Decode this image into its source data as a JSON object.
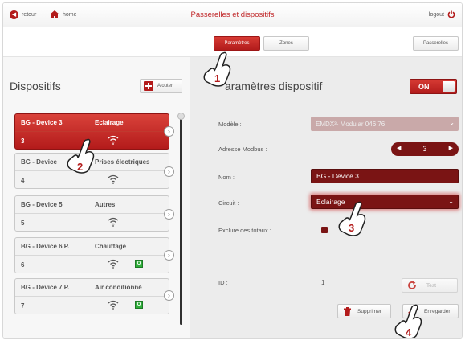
{
  "header": {
    "back_label": "retour",
    "home_label": "home",
    "title": "Passerelles et dispositifs",
    "logout_label": "logout"
  },
  "tabs": {
    "parametres": "Paramètres",
    "zones": "Zones",
    "passerelles": "Passerelles"
  },
  "left_panel": {
    "title": "Dispositifs",
    "add_label": "Ajouter",
    "devices": [
      {
        "name": "BG - Device 3",
        "circuit": "Eclairage",
        "number": "3",
        "active": true,
        "on": false
      },
      {
        "name": "BG - Device",
        "circuit": "Prises électriques",
        "number": "4",
        "active": false,
        "on": false
      },
      {
        "name": "BG - Device 5",
        "circuit": "Autres",
        "number": "5",
        "active": false,
        "on": false
      },
      {
        "name": "BG - Device 6 P.",
        "circuit": "Chauffage",
        "number": "6",
        "active": false,
        "on": true
      },
      {
        "name": "BG - Device 7 P.",
        "circuit": "Air conditionné",
        "number": "7",
        "active": false,
        "on": true
      }
    ],
    "on_badge": "O"
  },
  "right_panel": {
    "title": "aramètres dispositif",
    "toggle_label": "ON",
    "modele_label": "Modèle :",
    "modele_value": "EMDX³- Modular 046 76",
    "modbus_label": "Adresse Modbus :",
    "modbus_value": "3",
    "nom_label": "Nom :",
    "nom_value": "BG - Device 3",
    "circuit_label": "Circuit :",
    "circuit_value": "Eclairage",
    "exclure_label": "Exclure des totaux :",
    "id_label": "ID :",
    "id_value": "1",
    "test_label": "Test",
    "supprimer_label": "Supprimer",
    "enregistrer_label": "Enregarder"
  },
  "callouts": [
    "1",
    "2",
    "3",
    "4"
  ],
  "colors": {
    "brand_red": "#b31b1b",
    "dark_red": "#7a1414",
    "status_green": "#2fae3a"
  }
}
